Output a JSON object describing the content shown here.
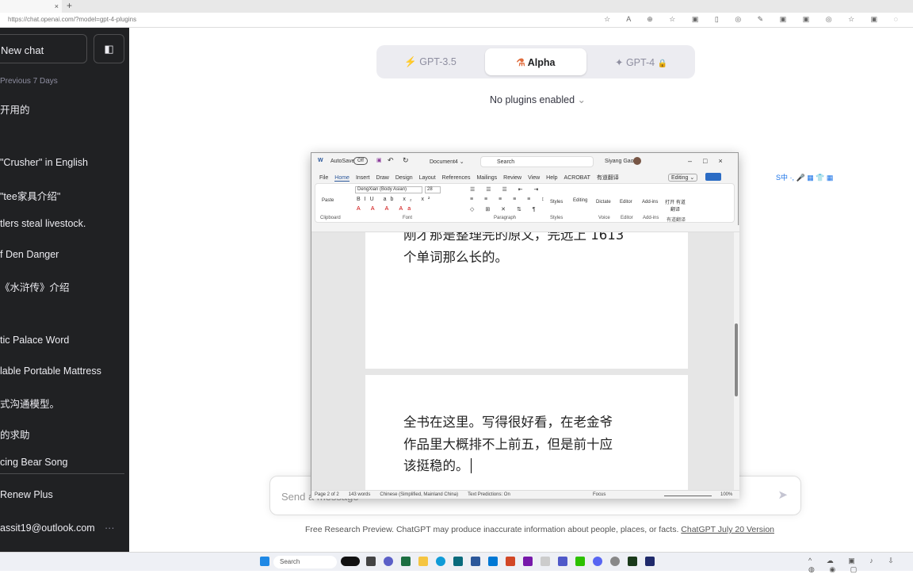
{
  "browser": {
    "url": "https://chat.openai.com/?model=gpt-4-plugins",
    "tab_close": "×",
    "new_tab": "+"
  },
  "sidebar": {
    "new_chat": "New chat",
    "section": "Previous 7 Days",
    "items": [
      "开用的",
      "\"Crusher\" in English",
      "\"tee家具介绍\"",
      "tlers steal livestock.",
      "f Den Danger",
      "《水浒传》介绍",
      "tic Palace Word",
      "lable Portable Mattress",
      "式沟通模型。",
      "的求助",
      "cing Bear Song"
    ],
    "renew": "Renew Plus",
    "account": "assit19@outlook.com",
    "more": "···"
  },
  "models": {
    "tabs": [
      {
        "label": "GPT-3.5",
        "icon": "⚡"
      },
      {
        "label": "Alpha",
        "icon": "⚗"
      },
      {
        "label": "GPT-4",
        "icon": "✦"
      }
    ],
    "active": "Alpha",
    "lock": "🔒"
  },
  "plugins": {
    "label": "No plugins enabled",
    "chevron": "⌄"
  },
  "input": {
    "placeholder": "Send a message",
    "send_icon": "➤"
  },
  "footer": {
    "text": "Free Research Preview. ChatGPT may produce inaccurate information about people, places, or facts. ",
    "link": "ChatGPT July 20 Version"
  },
  "word": {
    "autosave": "AutoSave",
    "autosave_state": "Off",
    "doc_name": "Document4 ⌄",
    "search": "Search",
    "user": "Siyang Gao",
    "menu": [
      "File",
      "Home",
      "Insert",
      "Draw",
      "Design",
      "Layout",
      "References",
      "Mailings",
      "Review",
      "View",
      "Help",
      "ACROBAT",
      "有道翻译"
    ],
    "editing_mode": "Editing ⌄",
    "font_name": "DengXian (Body Asian)",
    "font_size": "28",
    "groups": [
      "Clipboard",
      "Font",
      "Paragraph",
      "Styles",
      "Voice",
      "Editor",
      "Add-ins",
      "有道翻译"
    ],
    "buttons": {
      "paste": "Paste",
      "styles": "Styles",
      "editing": "Editing",
      "dictate": "Dictate",
      "editor": "Editor",
      "addins": "Add-ins",
      "translate": "打开 有道翻译"
    },
    "page1_lines": [
      "刚才那是整理完的原文，完远上 1613",
      "个单词那么长的。"
    ],
    "page2_lines": [
      "全书在这里。写得很好看，在老金爷",
      "作品里大概排不上前五，但是前十应",
      "该挺稳的。"
    ],
    "status": {
      "page": "Page 2 of 2",
      "words": "143 words",
      "language": "Chinese (Simplified, Mainland China)",
      "predictions": "Text Predictions: On",
      "focus": "Focus",
      "zoom": "100%"
    }
  },
  "ime": "S中 ·, 🎤 ▦ 👕 ▦",
  "taskbar": {
    "search": "Search"
  }
}
